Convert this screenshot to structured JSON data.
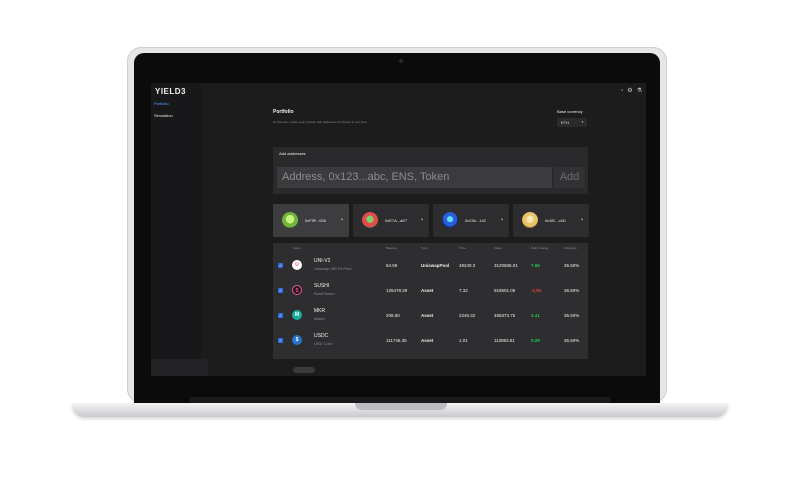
{
  "app": {
    "logo": "YIELD3",
    "nav": [
      {
        "label": "Portfolio",
        "active": true
      },
      {
        "label": "Simulation",
        "active": false
      }
    ]
  },
  "topbar_icons": [
    "square-icon",
    "gear-icon",
    "flask-icon"
  ],
  "page": {
    "title": "Portfolio",
    "subtitle": "Hi Normies, create your portfolio with addresses of interest to you here...",
    "base_currency_label": "Base currency",
    "base_currency_value": "ETH"
  },
  "add_addresses": {
    "title": "Add addresses",
    "placeholder": "Address, 0x123...abc, ENS, Token",
    "button": "Add"
  },
  "wallets": [
    {
      "address": "0xF9F...006",
      "menu": "•",
      "color": "#8fd14f",
      "selected": true
    },
    {
      "address": "0xE7A...aE7",
      "menu": "•",
      "color": "#e24b4b",
      "selected": false
    },
    {
      "address": "0x23b...142",
      "menu": "•",
      "color": "#2b5fd9",
      "selected": false
    },
    {
      "address": "0x3fC...c0D",
      "menu": "•",
      "color": "#e8c36a",
      "selected": false
    }
  ],
  "table": {
    "headers": [
      "Asset",
      "Balance",
      "Type",
      "Price",
      "Value",
      "Daily change",
      "Allocation"
    ],
    "rows": [
      {
        "symbol": "UNI-V2",
        "name": "Uniswap WETH Pool",
        "balance": "64.69",
        "type": "UniswapPool",
        "price": "48240.3",
        "value": "3120665.01",
        "change": "7.69",
        "change_dir": "pos",
        "allocation": "36.50%",
        "icon_color": "#ff4d8d",
        "icon_glyph": "🦄"
      },
      {
        "symbol": "SUSHI",
        "name": "SushiToken",
        "balance": "125478.29",
        "type": "Asset",
        "price": "7.32",
        "value": "918501.08",
        "change": "-1.81",
        "change_dir": "neg",
        "allocation": "36.50%",
        "icon_color": "#fa52a0",
        "icon_glyph": "S"
      },
      {
        "symbol": "MKR",
        "name": "Maker",
        "balance": "208.60",
        "type": "Asset",
        "price": "2245.32",
        "value": "468373.75",
        "change": "3.41",
        "change_dir": "pos",
        "allocation": "36.50%",
        "icon_color": "#1aab9b",
        "icon_glyph": "M"
      },
      {
        "symbol": "USDC",
        "name": "USD Coin",
        "balance": "111746.35",
        "type": "Asset",
        "price": "1.01",
        "value": "112863.81",
        "change": "0.29",
        "change_dir": "pos",
        "allocation": "36.50%",
        "icon_color": "#2775ca",
        "icon_glyph": "$"
      }
    ]
  }
}
